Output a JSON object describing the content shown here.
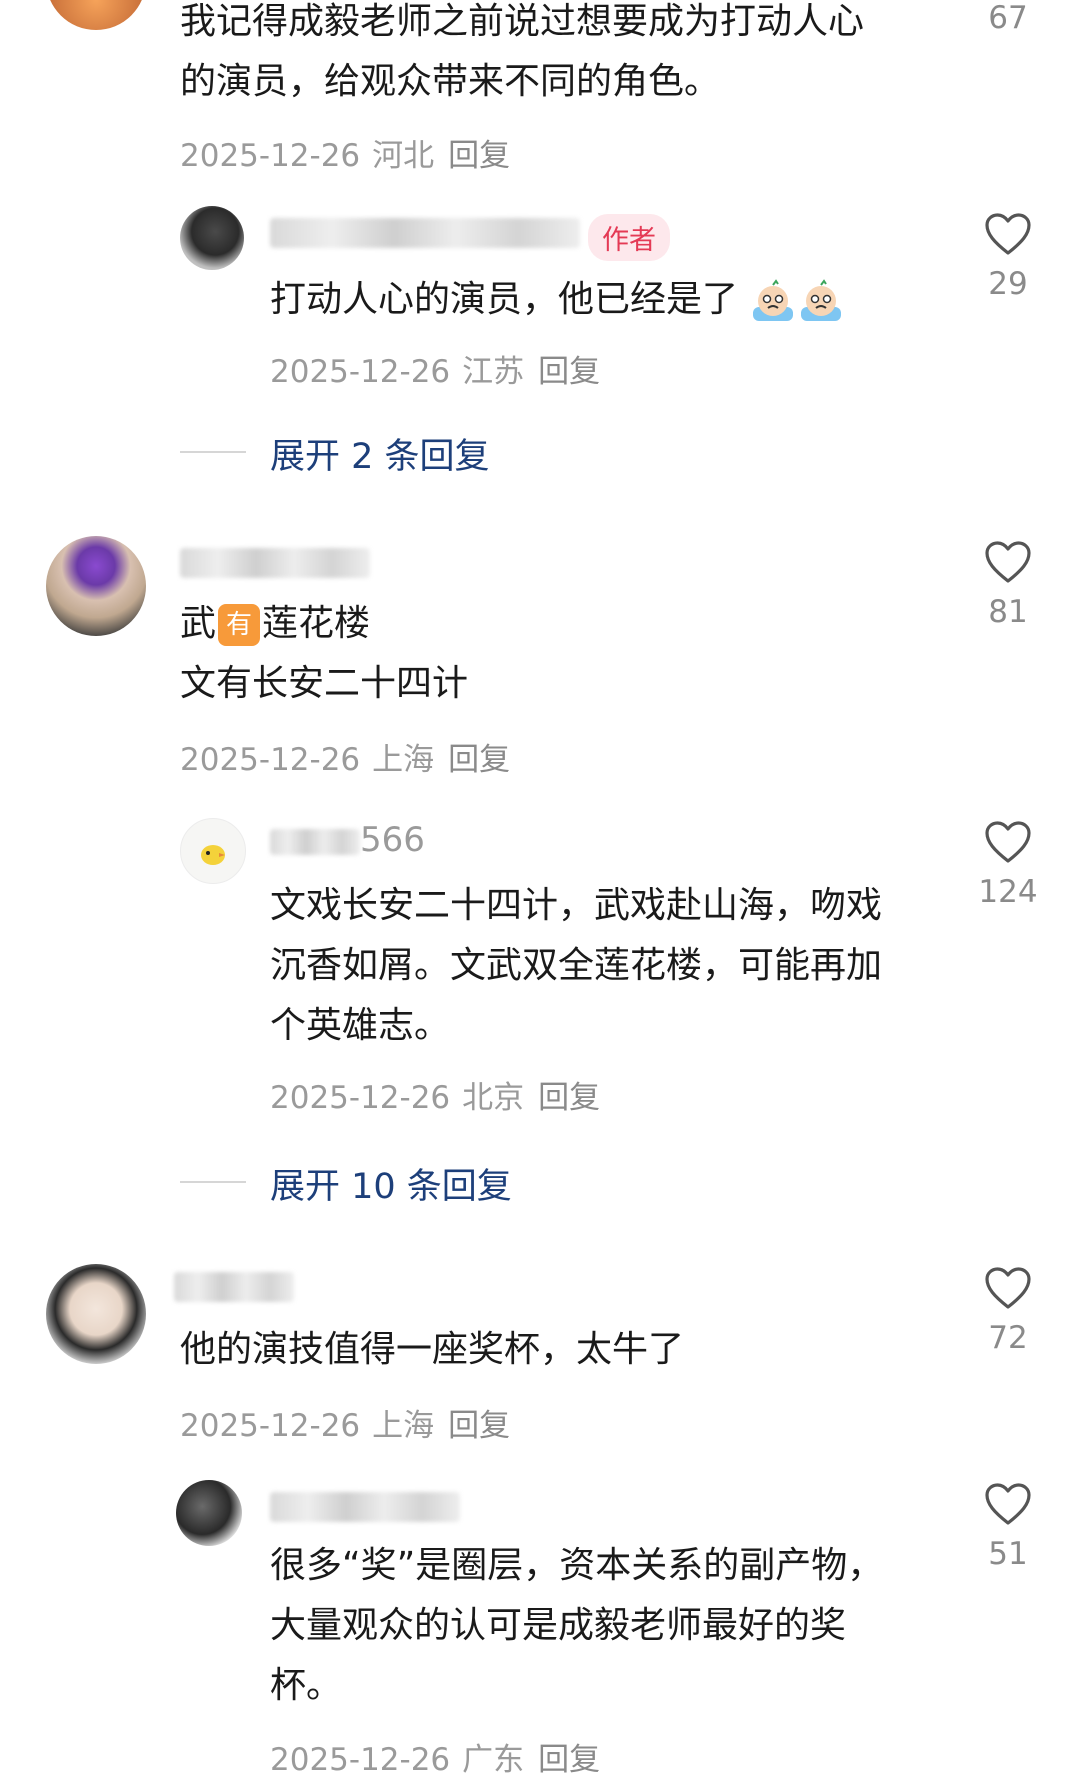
{
  "comments": [
    {
      "text_lines": [
        "我记得成毅老师之前说过想要成为打动人心",
        "的演员，给观众带来不同的角色。"
      ],
      "date": "2025-12-26",
      "location": "河北",
      "reply": "回复",
      "likes": "67"
    },
    {
      "author_badge": "作者",
      "text": "打动人心的演员，他已经是了",
      "date": "2025-12-26",
      "location": "江苏",
      "reply": "回复",
      "likes": "29"
    },
    {
      "username": "",
      "text_line1_a": "武",
      "text_line1_tag": "有",
      "text_line1_b": "莲花楼",
      "text_line2": "文有长安二十四计",
      "date": "2025-12-26",
      "location": "上海",
      "reply": "回复",
      "likes": "81"
    },
    {
      "username": "566",
      "text_lines": [
        "文戏长安二十四计，武戏赴山海，吻戏",
        "沉香如屑。文武双全莲花楼，可能再加",
        "个英雄志。"
      ],
      "date": "2025-12-26",
      "location": "北京",
      "reply": "回复",
      "likes": "124"
    },
    {
      "text": "他的演技值得一座奖杯，太牛了",
      "date": "2025-12-26",
      "location": "上海",
      "reply": "回复",
      "likes": "72"
    },
    {
      "text_lines": [
        "很多“奖”是圈层，资本关系的副产物，",
        "大量观众的认可是成毅老师最好的奖",
        "杯。"
      ],
      "date": "2025-12-26",
      "location": "广东",
      "reply": "回复",
      "likes": "51"
    }
  ],
  "expand_1": "展开 2 条回复",
  "expand_2": "展开 10 条回复",
  "icons": {
    "like": "heart-outline-icon",
    "emoji": "crying-face-emoji-icon"
  },
  "colors": {
    "expand_link": "#1d3f7a",
    "author_badge_bg": "#fde8ec",
    "author_badge_text": "#e43a55",
    "tag_orange": "#f79a3a"
  }
}
